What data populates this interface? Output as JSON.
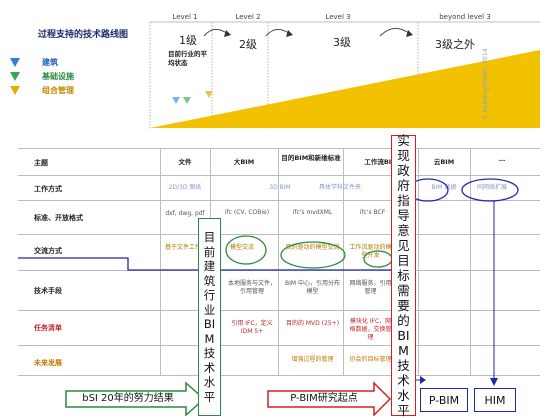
{
  "header": {
    "title": "过程支持的技术路线图",
    "current_level_note": "目前行业的平均状态"
  },
  "legend": [
    {
      "label": "建筑",
      "color": "#2e7fd6"
    },
    {
      "label": "基础设施",
      "color": "#3aa655"
    },
    {
      "label": "组合管理",
      "color": "#e0b100"
    }
  ],
  "levels": [
    "Level 1",
    "Level 2",
    "Level 3",
    "beyond level 3"
  ],
  "grades": [
    "1级",
    "2级",
    "3级",
    "3级之外"
  ],
  "watermark": "© buildingSMART, 2014",
  "table": {
    "columns": [
      "主题",
      "文件",
      "大BIM",
      "目的BIM和新维标准",
      "工作流BIM",
      "云BIM",
      "…"
    ],
    "rows": [
      {
        "label": "工作方式",
        "cells": [
          "2D/3D 图纸",
          "3D BIM",
          "具体学科文件夹",
          "BIM 数据",
          "同网络扩展"
        ]
      },
      {
        "label": "标准、开放格式",
        "cells": [
          "dxf, dwg, pdf",
          "ifc (CV, COBie)",
          "ifc's mvdXML",
          "ifc's BCF"
        ]
      },
      {
        "label": "交流方式",
        "cells": [
          "基于文件工作",
          "模型交流",
          "目的驱动的模型交流",
          "工作流驱动的模型开发"
        ]
      },
      {
        "label": "技术手段",
        "cells": [
          "",
          "本地服务与文件，引用管理",
          "BIM 中心，引用分布模型",
          "网络服务，引用管理"
        ]
      },
      {
        "label": "任务清单",
        "cells": [
          "",
          "引用 IFC，定义 IDM 5+",
          "目的的 MVD (25+)",
          "模块化 IFC，网格数据，交换管理"
        ]
      },
      {
        "label": "未来发展",
        "cells": [
          "",
          "",
          "增强过程的管理",
          "协会的目标管理"
        ]
      }
    ]
  },
  "annotations": {
    "green_box": "目前建筑行业BIM技术水平",
    "red_box": "实现政府指导意见目标需要的BIM技术水平",
    "green_arrow": "bSI 20年的努力结果",
    "red_arrow": "P-BIM研究起点",
    "out_pbim": "P-BIM",
    "out_him": "HIM"
  }
}
